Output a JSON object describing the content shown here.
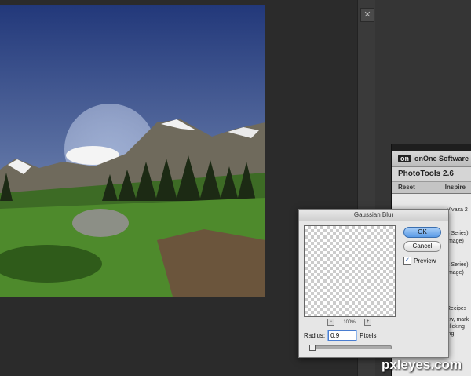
{
  "dialog": {
    "title": "Gaussian Blur",
    "ok_label": "OK",
    "cancel_label": "Cancel",
    "preview_label": "Preview",
    "zoom_level": "100%",
    "zoom_out": "−",
    "zoom_in": "+",
    "radius_label": "Radius:",
    "radius_value": "0.9",
    "radius_unit": "Pixels"
  },
  "onone_panel": {
    "logo_mark": "on",
    "logo_text": "onOne Software",
    "product": "PhotoTools 2.6",
    "reset_label": "Reset",
    "inspire_label": "Inspire",
    "items": [
      "Vivaza 2",
      "s Series)",
      "Image)",
      "s Series)",
      "Image)",
      "Recipes",
      "ew, mark",
      "clicking",
      "ing"
    ]
  },
  "watermark": "pxleyes.com"
}
